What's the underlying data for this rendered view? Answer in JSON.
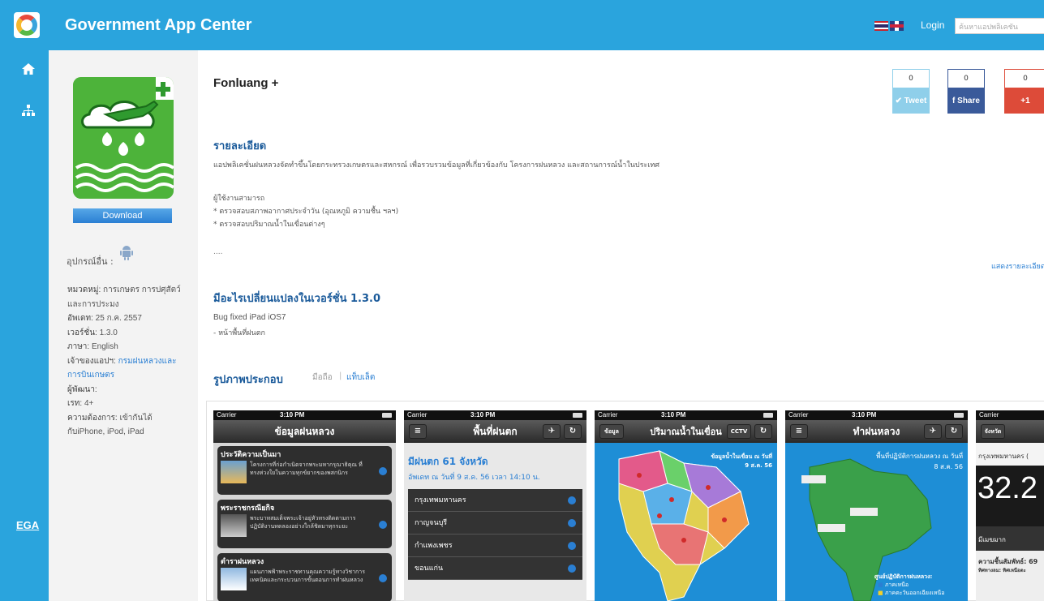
{
  "header": {
    "title": "Government App Center",
    "login_label": "Login",
    "search_placeholder": "ค้นหาแอปพลิเคชัน"
  },
  "nav": {
    "ega_label": "EGA"
  },
  "app": {
    "name": "Fonluang +",
    "download_label": "Download",
    "other_devices_label": "อุปกรณ์อื่น :",
    "category": "หมวดหมู่: การเกษตร การปศุสัตว์ และการประมง",
    "category_label": "หมวดหมู่:",
    "category_value": "การเกษตร การปศุสัตว์ และการประมง",
    "updated_label": "อัพเดท:",
    "updated_value": "25 ก.ค. 2557",
    "version_label": "เวอร์ชั่น:",
    "version_value": "1.3.0",
    "language_label": "ภาษา:",
    "language_value": "English",
    "owner_label": "เจ้าของแอปฯ:",
    "owner_value": "กรมฝนหลวงและการบินเกษตร",
    "developer_label": "ผู้พัฒนา:",
    "developer_value": "",
    "rating_label": "เรท:",
    "rating_value": "4+",
    "requirements_label": "ความต้องการ:",
    "requirements_value": "เข้ากันได้กับiPhone, iPod, iPad"
  },
  "social": {
    "tweet_count": "0",
    "tweet_label": "Tweet",
    "share_count": "0",
    "share_label": "Share",
    "plus_count": "0",
    "plus_label": "+1"
  },
  "details": {
    "heading": "รายละเอียด",
    "description": "แอปพลิเคชั่นฝนหลวงจัดทำขึ้นโดยกระทรวงเกษตรและสหกรณ์ เพื่อรวบรวมข้อมูลที่เกี่ยวข้องกับ โครงการฝนหลวง และสถานการณ์น้ำในประเทศ",
    "users_title": "ผู้ใช้งานสามารถ",
    "users_line1": "* ตรวจสอบสภาพอากาศประจำวัน (อุณหภูมิ ความชื้น ฯลฯ)",
    "users_line2": "* ตรวจสอบปริมาณน้ำในเขื่อนต่างๆ",
    "ellipsis": "....",
    "show_more": "แสดงรายละเอียด"
  },
  "changes": {
    "heading": "มีอะไรเปลี่ยนแปลงในเวอร์ชั่น 1.3.0",
    "line1": "Bug fixed iPad iOS7",
    "line2": "- หน้าพื้นที่ฝนตก"
  },
  "screenshots": {
    "heading": "รูปภาพประกอบ",
    "tab_phone": "มือถือ",
    "tab_separator": "|",
    "tab_tablet": "แท็บเล็ต",
    "carrier": "Carrier",
    "time": "3:10 PM",
    "shot1_title": "ข้อมูลฝนหลวง",
    "shot1_sections": [
      {
        "title": "ประวัติความเป็นมา",
        "desc": "โครงการที่ก่อกำเนิดจากพระมหากรุณาธิคุณ ที่ทรงห่วงใยในความทุกข์ยากของพสกนิกร"
      },
      {
        "title": "พระราชกรณียกิจ",
        "desc": "พระบาทสมเด็จพระเจ้าอยู่หัวทรงติดตามการปฏิบัติงานทดลองอย่างใกล้ชิดมาทุกระยะ"
      },
      {
        "title": "ตำราฝนหลวง",
        "desc": "แผนภาพฟ้าพระราชทานคุณความรู้ทางวิชาการเทคนิคและกระบวนการขั้นตอนการทำฝนหลวง"
      }
    ],
    "shot2_title": "พื้นที่ฝนตก",
    "shot2_big": "มีฝนตก 61 จังหวัด",
    "shot2_sub": "อัพเดท ณ วันที่  9 ส.ค. 56  เวลา 14:10 น.",
    "shot2_provinces": [
      "กรุงเทพมหานคร",
      "กาญจนบุรี",
      "กำแพงเพชร",
      "ขอนแก่น"
    ],
    "shot3_title": "ปริมาณน้ำในเขื่อน",
    "shot3_left_btn": "ข้อมูล",
    "shot3_right_btn": "CCTV",
    "shot3_caption": "ข้อมูลน้ำในเขื่อน ณ วันที่ 9 ส.ค. 56",
    "shot4_title": "ทำฝนหลวง",
    "shot4_caption": "พื้นที่ปฏิบัติการฝนหลวง ณ วันที่ 8 ส.ค. 56",
    "shot4_legend": "ศูนย์ปฏิบัติการฝนหลวง:",
    "shot4_legend1": "ภาคเหนือ",
    "shot4_legend2": "ภาคตะวันออกเฉียงเหนือ",
    "shot5_btn": "จังหวัด",
    "shot5_city": "กรุงเทพมหานคร (",
    "shot5_temp": "32.2",
    "shot5_weather": "มีเมฆมาก",
    "shot5_humidity": "ความชื้นสัมพัทธ์: 69",
    "shot5_wind": "ทิศทางลม: ทิศเหนือตะ"
  }
}
